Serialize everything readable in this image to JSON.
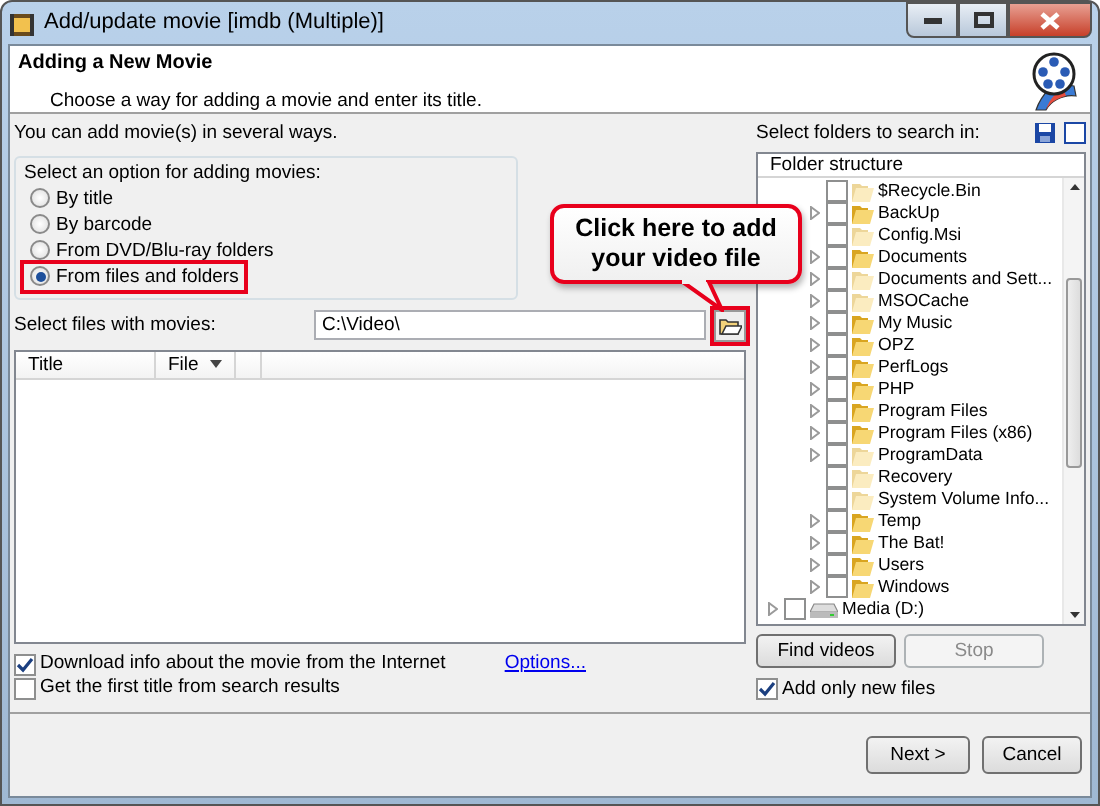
{
  "window": {
    "title": "Add/update movie [imdb (Multiple)]"
  },
  "header": {
    "title": "Adding a New Movie",
    "subtitle": "Choose a way for adding a movie and enter its title."
  },
  "intro": "You can add movie(s) in several ways.",
  "options_group": {
    "label": "Select an option for adding movies:",
    "options": [
      {
        "label": "By title",
        "selected": false,
        "highlighted": false
      },
      {
        "label": "By barcode",
        "selected": false,
        "highlighted": false
      },
      {
        "label": "From DVD/Blu-ray folders",
        "selected": false,
        "highlighted": false
      },
      {
        "label": "From files and folders",
        "selected": true,
        "highlighted": true
      }
    ]
  },
  "files": {
    "label": "Select files with movies:",
    "value": "C:\\Video\\",
    "browse_highlighted": true
  },
  "callout": "Click here to add your video file",
  "table": {
    "columns": [
      {
        "label": "Title",
        "sorted": false
      },
      {
        "label": "File",
        "sorted": true
      }
    ]
  },
  "checkboxes": [
    {
      "label": "Download info about the movie from the Internet",
      "checked": true
    },
    {
      "label": "Get the first title from search results",
      "checked": false
    }
  ],
  "options_link": "Options...",
  "folders": {
    "label": "Select folders to search in:",
    "header": "Folder structure",
    "tree": [
      {
        "children": [
          {
            "label": "$Recycle.Bin",
            "expandable": false,
            "checked": false,
            "hidden": true
          },
          {
            "label": "BackUp",
            "expandable": true,
            "checked": false,
            "hidden": false
          },
          {
            "label": "Config.Msi",
            "expandable": false,
            "checked": false,
            "hidden": true
          },
          {
            "label": "Documents",
            "expandable": true,
            "checked": false,
            "hidden": false
          },
          {
            "label": "Documents and Sett...",
            "expandable": true,
            "checked": false,
            "hidden": true
          },
          {
            "label": "MSOCache",
            "expandable": true,
            "checked": false,
            "hidden": true
          },
          {
            "label": "My Music",
            "expandable": true,
            "checked": false,
            "hidden": false
          },
          {
            "label": "OPZ",
            "expandable": true,
            "checked": false,
            "hidden": false
          },
          {
            "label": "PerfLogs",
            "expandable": true,
            "checked": false,
            "hidden": false
          },
          {
            "label": "PHP",
            "expandable": true,
            "checked": false,
            "hidden": false
          },
          {
            "label": "Program Files",
            "expandable": true,
            "checked": false,
            "hidden": false
          },
          {
            "label": "Program Files (x86)",
            "expandable": true,
            "checked": false,
            "hidden": false
          },
          {
            "label": "ProgramData",
            "expandable": true,
            "checked": false,
            "hidden": true
          },
          {
            "label": "Recovery",
            "expandable": false,
            "checked": false,
            "hidden": true
          },
          {
            "label": "System Volume Info...",
            "expandable": false,
            "checked": false,
            "hidden": true
          },
          {
            "label": "Temp",
            "expandable": true,
            "checked": false,
            "hidden": false
          },
          {
            "label": "The Bat!",
            "expandable": true,
            "checked": false,
            "hidden": false
          },
          {
            "label": "Users",
            "expandable": true,
            "checked": false,
            "hidden": false
          },
          {
            "label": "Windows",
            "expandable": true,
            "checked": false,
            "hidden": false
          }
        ]
      },
      {
        "kind": "drive",
        "label": "Media (D:)",
        "expandable": true,
        "checked": false
      }
    ]
  },
  "search_buttons": [
    {
      "label": "Find videos",
      "disabled": false
    },
    {
      "label": "Stop",
      "disabled": true
    }
  ],
  "only_new": {
    "label": "Add only new files",
    "checked": true
  },
  "footer_buttons": [
    "Next >",
    "Cancel"
  ]
}
